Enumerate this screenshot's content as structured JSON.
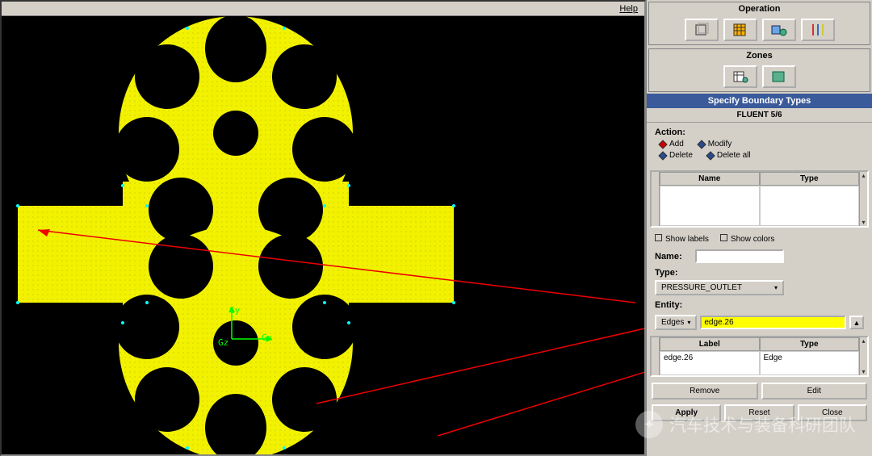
{
  "menu": {
    "help": "Help"
  },
  "panels": {
    "operation": {
      "title": "Operation"
    },
    "zones": {
      "title": "Zones"
    }
  },
  "boundary": {
    "titlebar": "Specify Boundary Types",
    "solver": "FLUENT 5/6",
    "action_label": "Action:",
    "actions": {
      "add": "Add",
      "modify": "Modify",
      "delete": "Delete",
      "delete_all": "Delete all"
    },
    "list1": {
      "col_name": "Name",
      "col_type": "Type"
    },
    "show_labels": "Show labels",
    "show_colors": "Show colors",
    "name_label": "Name:",
    "name_value": "",
    "type_label": "Type:",
    "type_value": "PRESSURE_OUTLET",
    "entity_label": "Entity:",
    "entity_kind": "Edges",
    "entity_value": "edge.26",
    "list2": {
      "col_label": "Label",
      "col_type": "Type",
      "row_label": "edge.26",
      "row_type": "Edge"
    },
    "buttons": {
      "remove": "Remove",
      "edit": "Edit",
      "apply": "Apply",
      "reset": "Reset",
      "close": "Close"
    }
  },
  "axis": {
    "gx": "Gx",
    "gy": "Gy",
    "gz": "Gz"
  },
  "watermark": "汽车技术与装备科研团队"
}
